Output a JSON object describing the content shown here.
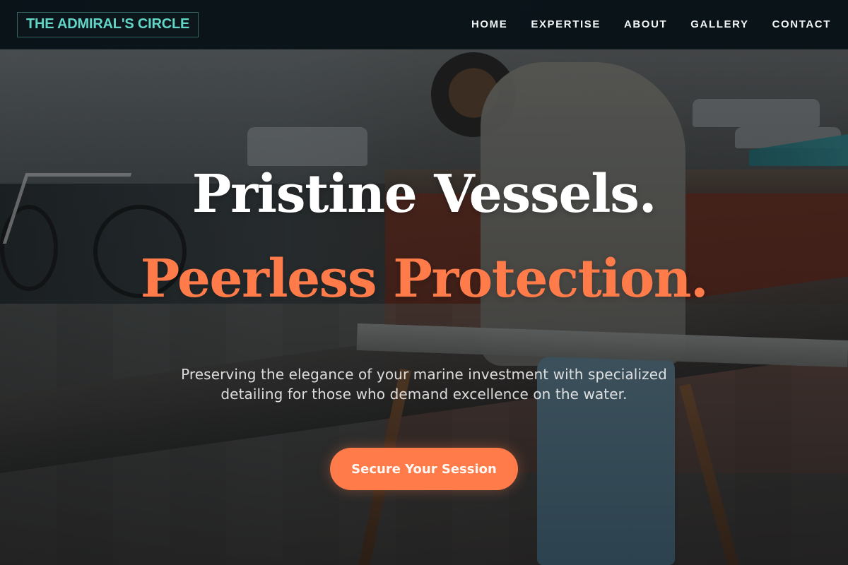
{
  "brand": {
    "logo_text": "THE ADMIRAL'S CIRCLE",
    "accent_color": "#61d6c7",
    "cta_color": "#ff7b49"
  },
  "nav": {
    "items": [
      {
        "label": "HOME"
      },
      {
        "label": "EXPERTISE"
      },
      {
        "label": "ABOUT"
      },
      {
        "label": "GALLERY"
      },
      {
        "label": "CONTACT"
      }
    ]
  },
  "hero": {
    "headline_line_1": "Pristine Vessels.",
    "headline_line_2": "Peerless Protection.",
    "subtext": "Preserving the elegance of your marine investment with specialized detailing for those who demand excellence on the water.",
    "cta_label": "Secure Your Session"
  }
}
